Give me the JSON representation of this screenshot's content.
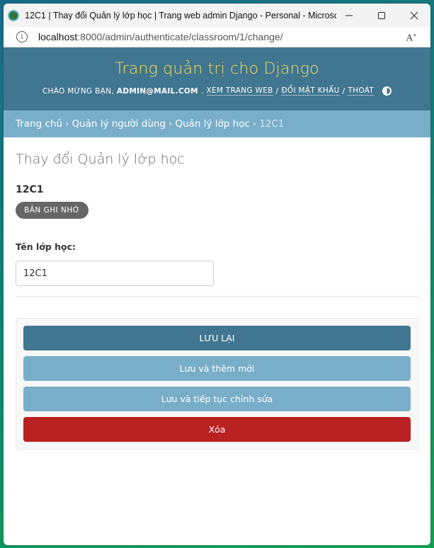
{
  "window": {
    "title": "12C1 | Thay đổi Quản lý lớp học | Trang web admin Django - Personal - Microsof..."
  },
  "address": {
    "host": "localhost",
    "path": ":8000/admin/authenticate/classroom/1/change/"
  },
  "header": {
    "branding": "Trang quản trị cho Django",
    "welcome": "Chào mừng bạn,",
    "user": "admin@mail.com",
    "view_site": "Xem trang web",
    "change_password": "Đổi mật khẩu",
    "logout": "Thoát"
  },
  "breadcrumbs": {
    "home": "Trang chủ",
    "app": "Quản lý người dùng",
    "model": "Quản lý lớp học",
    "current": "12C1"
  },
  "content": {
    "page_title": "Thay đổi Quản lý lớp học",
    "object_title": "12C1",
    "history_label": "Bản ghi nhớ",
    "field_label": "Tên lớp học:",
    "field_value": "12C1"
  },
  "actions": {
    "save": "Lưu lại",
    "save_add": "Lưu và thêm mới",
    "save_continue": "Lưu và tiếp tục chỉnh sửa",
    "delete": "Xóa"
  },
  "colors": {
    "header_bg": "#417690",
    "branding": "#f5dd5d",
    "breadcrumbs_bg": "#79aec8",
    "delete": "#ba2121"
  }
}
